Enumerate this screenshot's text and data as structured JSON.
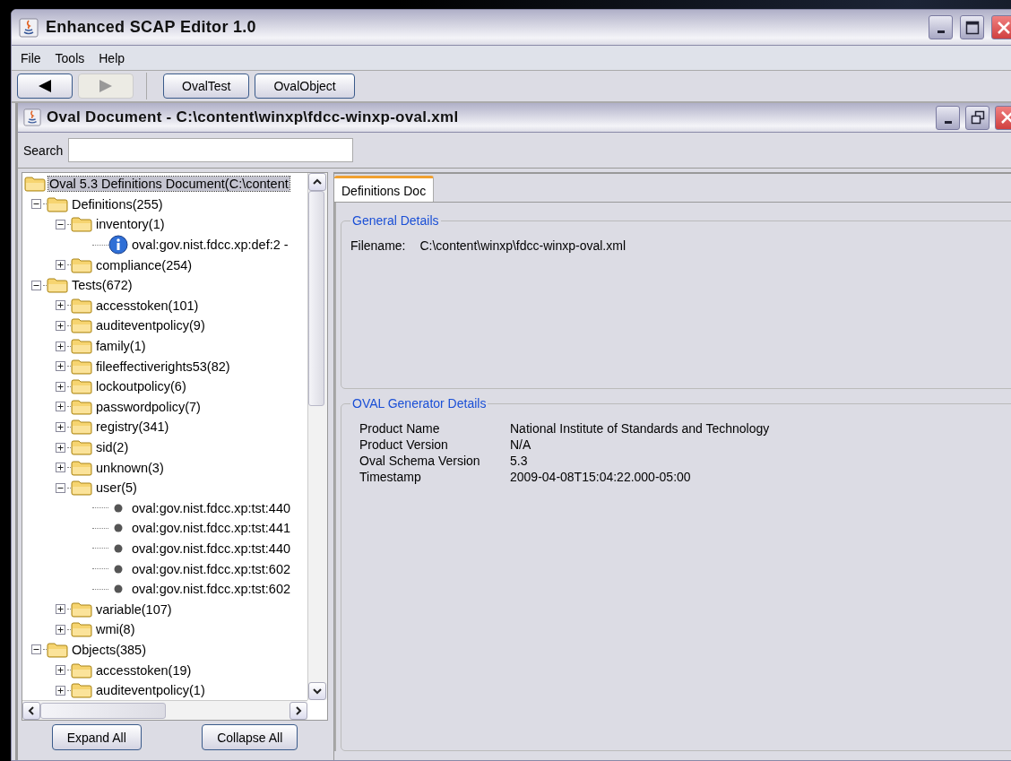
{
  "window": {
    "title": "Enhanced SCAP Editor 1.0"
  },
  "menu": [
    "File",
    "Tools",
    "Help"
  ],
  "toolbar": {
    "back": {
      "disabled": false
    },
    "forward": {
      "disabled": true
    },
    "buttons": [
      "OvalTest",
      "OvalObject"
    ]
  },
  "document": {
    "title": "Oval Document - C:\\content\\winxp\\fdcc-winxp-oval.xml",
    "search": {
      "label": "Search"
    },
    "tree": [
      {
        "label": "Oval 5.3 Definitions Document(C:\\content",
        "kind": "folder",
        "selected": true,
        "children": [
          {
            "label": "Definitions(255)",
            "kind": "folder",
            "expanded": true,
            "selected": false,
            "children": [
              {
                "label": "inventory(1)",
                "kind": "folder",
                "expanded": true,
                "selected": false,
                "children": [
                  {
                    "label": "oval:gov.nist.fdcc.xp:def:2 -",
                    "kind": "info",
                    "selected": false
                  }
                ]
              },
              {
                "label": "compliance(254)",
                "kind": "folder",
                "expanded": false,
                "selected": false
              }
            ]
          },
          {
            "label": "Tests(672)",
            "kind": "folder",
            "expanded": true,
            "selected": false,
            "children": [
              {
                "label": "accesstoken(101)",
                "kind": "folder",
                "expanded": false,
                "selected": false
              },
              {
                "label": "auditeventpolicy(9)",
                "kind": "folder",
                "expanded": false,
                "selected": false
              },
              {
                "label": "family(1)",
                "kind": "folder",
                "expanded": false,
                "selected": false
              },
              {
                "label": "fileeffectiverights53(82)",
                "kind": "folder",
                "expanded": false,
                "selected": false
              },
              {
                "label": "lockoutpolicy(6)",
                "kind": "folder",
                "expanded": false,
                "selected": false
              },
              {
                "label": "passwordpolicy(7)",
                "kind": "folder",
                "expanded": false,
                "selected": false
              },
              {
                "label": "registry(341)",
                "kind": "folder",
                "expanded": false,
                "selected": false
              },
              {
                "label": "sid(2)",
                "kind": "folder",
                "expanded": false,
                "selected": false
              },
              {
                "label": "unknown(3)",
                "kind": "folder",
                "expanded": false,
                "selected": false
              },
              {
                "label": "user(5)",
                "kind": "folder",
                "expanded": true,
                "selected": false,
                "children": [
                  {
                    "label": "oval:gov.nist.fdcc.xp:tst:440",
                    "kind": "item",
                    "selected": false
                  },
                  {
                    "label": "oval:gov.nist.fdcc.xp:tst:441",
                    "kind": "item",
                    "selected": false
                  },
                  {
                    "label": "oval:gov.nist.fdcc.xp:tst:440",
                    "kind": "item",
                    "selected": false
                  },
                  {
                    "label": "oval:gov.nist.fdcc.xp:tst:602",
                    "kind": "item",
                    "selected": false
                  },
                  {
                    "label": "oval:gov.nist.fdcc.xp:tst:602",
                    "kind": "item",
                    "selected": false
                  }
                ]
              },
              {
                "label": "variable(107)",
                "kind": "folder",
                "expanded": false,
                "selected": false
              },
              {
                "label": "wmi(8)",
                "kind": "folder",
                "expanded": false,
                "selected": false
              }
            ]
          },
          {
            "label": "Objects(385)",
            "kind": "folder",
            "expanded": true,
            "selected": false,
            "children": [
              {
                "label": "accesstoken(19)",
                "kind": "folder",
                "expanded": false,
                "selected": false
              },
              {
                "label": "auditeventpolicy(1)",
                "kind": "folder",
                "expanded": false,
                "selected": false
              }
            ]
          }
        ]
      }
    ],
    "tree_buttons": [
      "Expand All",
      "Collapse All"
    ],
    "tabs": [
      {
        "label": "Definitions Doc",
        "selected": true
      }
    ],
    "general_details": {
      "title": "General Details",
      "filename_label": "Filename:",
      "filename": "C:\\content\\winxp\\fdcc-winxp-oval.xml"
    },
    "generator_details": {
      "title": "OVAL Generator Details",
      "rows": [
        {
          "label": "Product Name",
          "value": "National Institute of Standards and Technology"
        },
        {
          "label": "Product Version",
          "value": "N/A"
        },
        {
          "label": "Oval Schema Version",
          "value": "5.3"
        },
        {
          "label": "Timestamp",
          "value": "2009-04-08T15:04:22.000-05:00"
        }
      ]
    }
  }
}
